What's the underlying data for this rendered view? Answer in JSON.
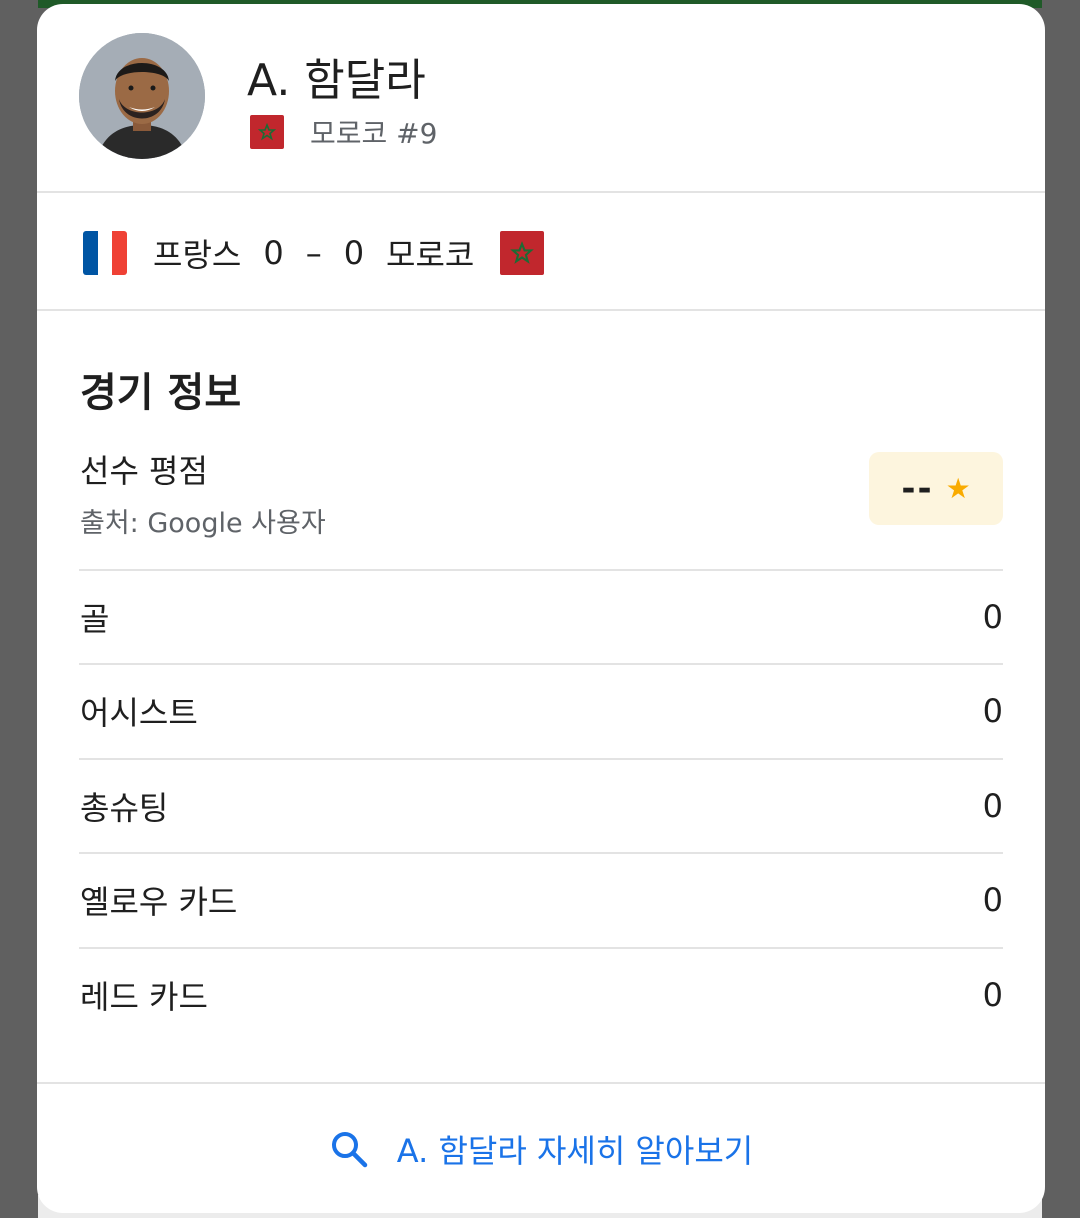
{
  "player": {
    "name": "A. 함달라",
    "team_line": "모로코 #9"
  },
  "match": {
    "home_team": "프랑스",
    "home_score": "0",
    "separator": "–",
    "away_score": "0",
    "away_team": "모로코"
  },
  "match_info": {
    "title": "경기 정보",
    "rating_label": "선수 평점",
    "rating_source": "출처: Google 사용자",
    "rating_value": "--",
    "stats": [
      {
        "label": "골",
        "value": "0"
      },
      {
        "label": "어시스트",
        "value": "0"
      },
      {
        "label": "총슈팅",
        "value": "0"
      },
      {
        "label": "옐로우 카드",
        "value": "0"
      },
      {
        "label": "레드 카드",
        "value": "0"
      }
    ]
  },
  "footer": {
    "more_link": "A. 함달라 자세히 알아보기"
  },
  "colors": {
    "accent_link": "#1a73e8",
    "rating_bg": "#fdf5de",
    "star": "#f9ab00",
    "morocco_red": "#c1272d",
    "france_blue": "#0055a4",
    "france_red": "#ef4135"
  },
  "icons": [
    "player-avatar",
    "morocco-flag",
    "france-flag",
    "star-icon",
    "search-icon"
  ]
}
